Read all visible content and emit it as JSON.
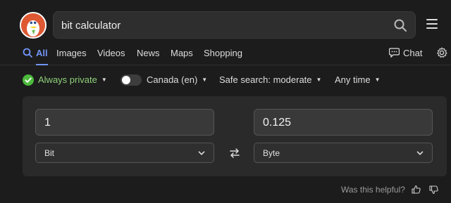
{
  "search": {
    "query": "bit calculator"
  },
  "tabs": [
    {
      "label": "All"
    },
    {
      "label": "Images"
    },
    {
      "label": "Videos"
    },
    {
      "label": "News"
    },
    {
      "label": "Maps"
    },
    {
      "label": "Shopping"
    }
  ],
  "chat": {
    "label": "Chat"
  },
  "filters": {
    "privacy": "Always private",
    "region": "Canada (en)",
    "safe_search": "Safe search: moderate",
    "time": "Any time"
  },
  "converter": {
    "from_value": "1",
    "to_value": "0.125",
    "from_unit": "Bit",
    "to_unit": "Byte"
  },
  "feedback": {
    "label": "Was this helpful?"
  },
  "colors": {
    "accent": "#7295f6",
    "private_green": "#8fd07a",
    "logo_orange": "#de5833"
  }
}
